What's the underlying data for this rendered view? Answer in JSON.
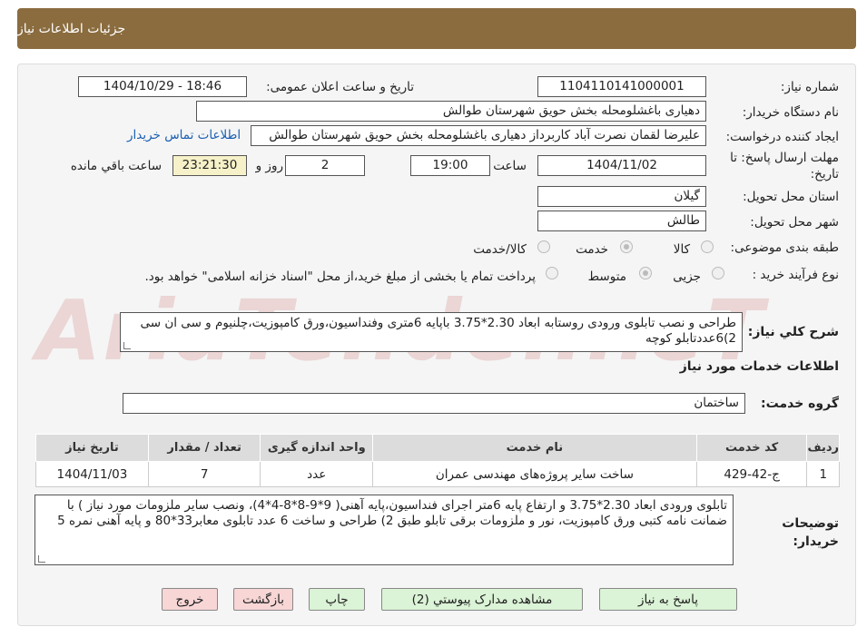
{
  "header": {
    "title": "جزئیات اطلاعات نیاز"
  },
  "watermark": {
    "text": "AriaTender.neT"
  },
  "form": {
    "need_number_label": "شماره نیاز:",
    "need_number": "1104110141000001",
    "announce_label": "تاریخ و ساعت اعلان عمومی:",
    "announce_value": "1404/10/29 - 18:46",
    "buyer_org_label": "نام دستگاه خریدار:",
    "buyer_org": "دهیاری باغشلومحله بخش حویق شهرستان طوالش",
    "creator_label": "ایجاد کننده درخواست:",
    "creator": "علیرضا لقمان نصرت آباد کاربرداز دهیاری باغشلومحله بخش حویق شهرستان طوالش",
    "contact_link": "اطلاعات تماس خریدار",
    "deadline_label": "مهلت ارسال پاسخ: تا تاریخ:",
    "deadline_date": "1404/11/02",
    "time_label": "ساعت",
    "deadline_time": "19:00",
    "days_value": "2",
    "days_label": "روز و",
    "remaining_time": "23:21:30",
    "remaining_label": "ساعت باقي مانده",
    "province_label": "استان محل تحویل:",
    "province": "گیلان",
    "city_label": "شهر محل تحویل:",
    "city": "طالش",
    "category_label": "طبقه بندی موضوعی:",
    "category_options": [
      "کالا",
      "خدمت",
      "کالا/خدمت"
    ],
    "process_label": "نوع فرآیند خرید :",
    "process_options": [
      "جزیی",
      "متوسط"
    ],
    "process_note": "پرداخت تمام یا بخشی از مبلغ خرید،از محل \"اسناد خزانه اسلامی\" خواهد بود.",
    "summary_label": "شرح کلي نیاز:",
    "summary": "طراحی و نصب تابلوی ورودی روستابه ابعاد 2.30*3.75 باپایه 6متری وفنداسیون،ورق کامپوزیت،چلنیوم و سی ان سی 2)6عددتابلو کوچه"
  },
  "services": {
    "section_title": "اطلاعات خدمات مورد نیاز",
    "group_label": "گروه خدمت:",
    "group_value": "ساختمان",
    "columns": [
      "ردیف",
      "کد خدمت",
      "نام خدمت",
      "واحد اندازه گیری",
      "تعداد / مقدار",
      "تاریخ نیاز"
    ],
    "rows": [
      [
        "1",
        "ج-42-429",
        "ساخت سایر پروژه‌های مهندسی عمران",
        "عدد",
        "7",
        "1404/11/03"
      ]
    ]
  },
  "buyer_notes": {
    "label": "توضیحات خریدار:",
    "text": "تابلوی ورودی ابعاد 2.30*3.75 و ارتفاع  پایه  6متر اجرای فنداسیون،پایه آهنی( 9*9-8*8-4*4)، ونصب سایر ملزومات مورد نیاز ) با ضمانت نامه کتبی ورق کامپوزیت، نور و ملزومات برقی تابلو طبق 2) طراحی و ساخت 6 عدد تابلوی معابر33*80 و پایه آهنی نمره 5"
  },
  "buttons": {
    "reply": "پاسخ به نیاز",
    "attachments": "مشاهده مدارک پیوستي (2)",
    "print": "چاپ",
    "back": "بازگشت",
    "exit": "خروج"
  },
  "colors": {
    "header_bg": "#8a6c3f",
    "link": "#1a5fb4",
    "green_button": "#dbf3d6",
    "pink_button": "#f8d6d6",
    "remaining_bg": "#f6f1c8"
  }
}
